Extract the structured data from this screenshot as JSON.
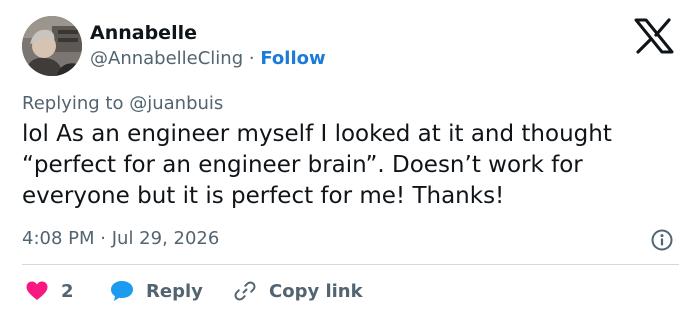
{
  "author": {
    "name": "Annabelle",
    "handle": "@AnnabelleCling",
    "separator": "·",
    "follow_label": "Follow"
  },
  "reply_context": {
    "prefix": "Replying to",
    "mention": "@juanbuis"
  },
  "tweet": {
    "text": "lol As an engineer myself I looked at it and thought “perfect for an engineer brain”. Doesn’t work for everyone but it is perfect for me! Thanks!",
    "time": "4:08 PM",
    "date_separator": "·",
    "date": "Jul 29, 2026"
  },
  "actions": {
    "like_count": "2",
    "reply_label": "Reply",
    "copy_label": "Copy link"
  },
  "colors": {
    "like": "#f91880",
    "reply": "#1d9bf0",
    "follow": "#1d7bd8",
    "secondary_text": "#536471",
    "primary_text": "#0f1419"
  },
  "icons": {
    "brand": "x-logo-icon",
    "info": "info-icon",
    "like": "heart-icon",
    "reply": "speech-bubble-icon",
    "copy": "link-icon"
  }
}
